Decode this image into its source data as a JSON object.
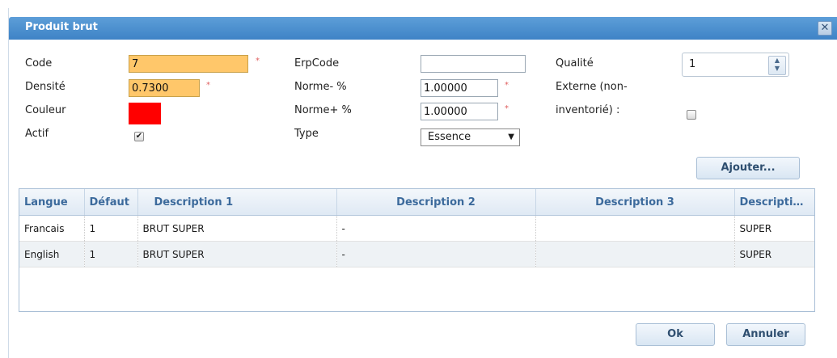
{
  "dialog": {
    "title": "Produit brut",
    "close_glyph": "✕"
  },
  "form": {
    "code_label": "Code",
    "code_value": "7",
    "densite_label": "Densité",
    "densite_value": "0.7300",
    "couleur_label": "Couleur",
    "couleur_color": "#ff0000",
    "actif_label": "Actif",
    "actif_checked": true,
    "erpcode_label": "ErpCode",
    "erpcode_value": "",
    "norme_minus_label": "Norme- %",
    "norme_minus_value": "1.00000",
    "norme_plus_label": "Norme+ %",
    "norme_plus_value": "1.00000",
    "type_label": "Type",
    "type_value": "Essence",
    "qualite_label": "Qualité",
    "qualite_value": "1",
    "externe_label_line1": "Externe (non-",
    "externe_label_line2": "inventorié) :",
    "externe_checked": false,
    "required_marker": "*"
  },
  "buttons": {
    "ajouter": "Ajouter...",
    "ok": "Ok",
    "annuler": "Annuler"
  },
  "grid": {
    "columns": [
      "Langue",
      "Défaut",
      "Description 1",
      "Description 2",
      "Description 3",
      "Descriptio..."
    ],
    "rows": [
      [
        "Francais",
        "1",
        "BRUT SUPER",
        "-",
        "",
        "SUPER"
      ],
      [
        "English",
        "1",
        "BRUT SUPER",
        "-",
        "",
        "SUPER"
      ]
    ]
  },
  "colors": {
    "title_bar": "#3e83c6",
    "required_field": "#ffc76a",
    "header_text": "#3c6a9c"
  }
}
